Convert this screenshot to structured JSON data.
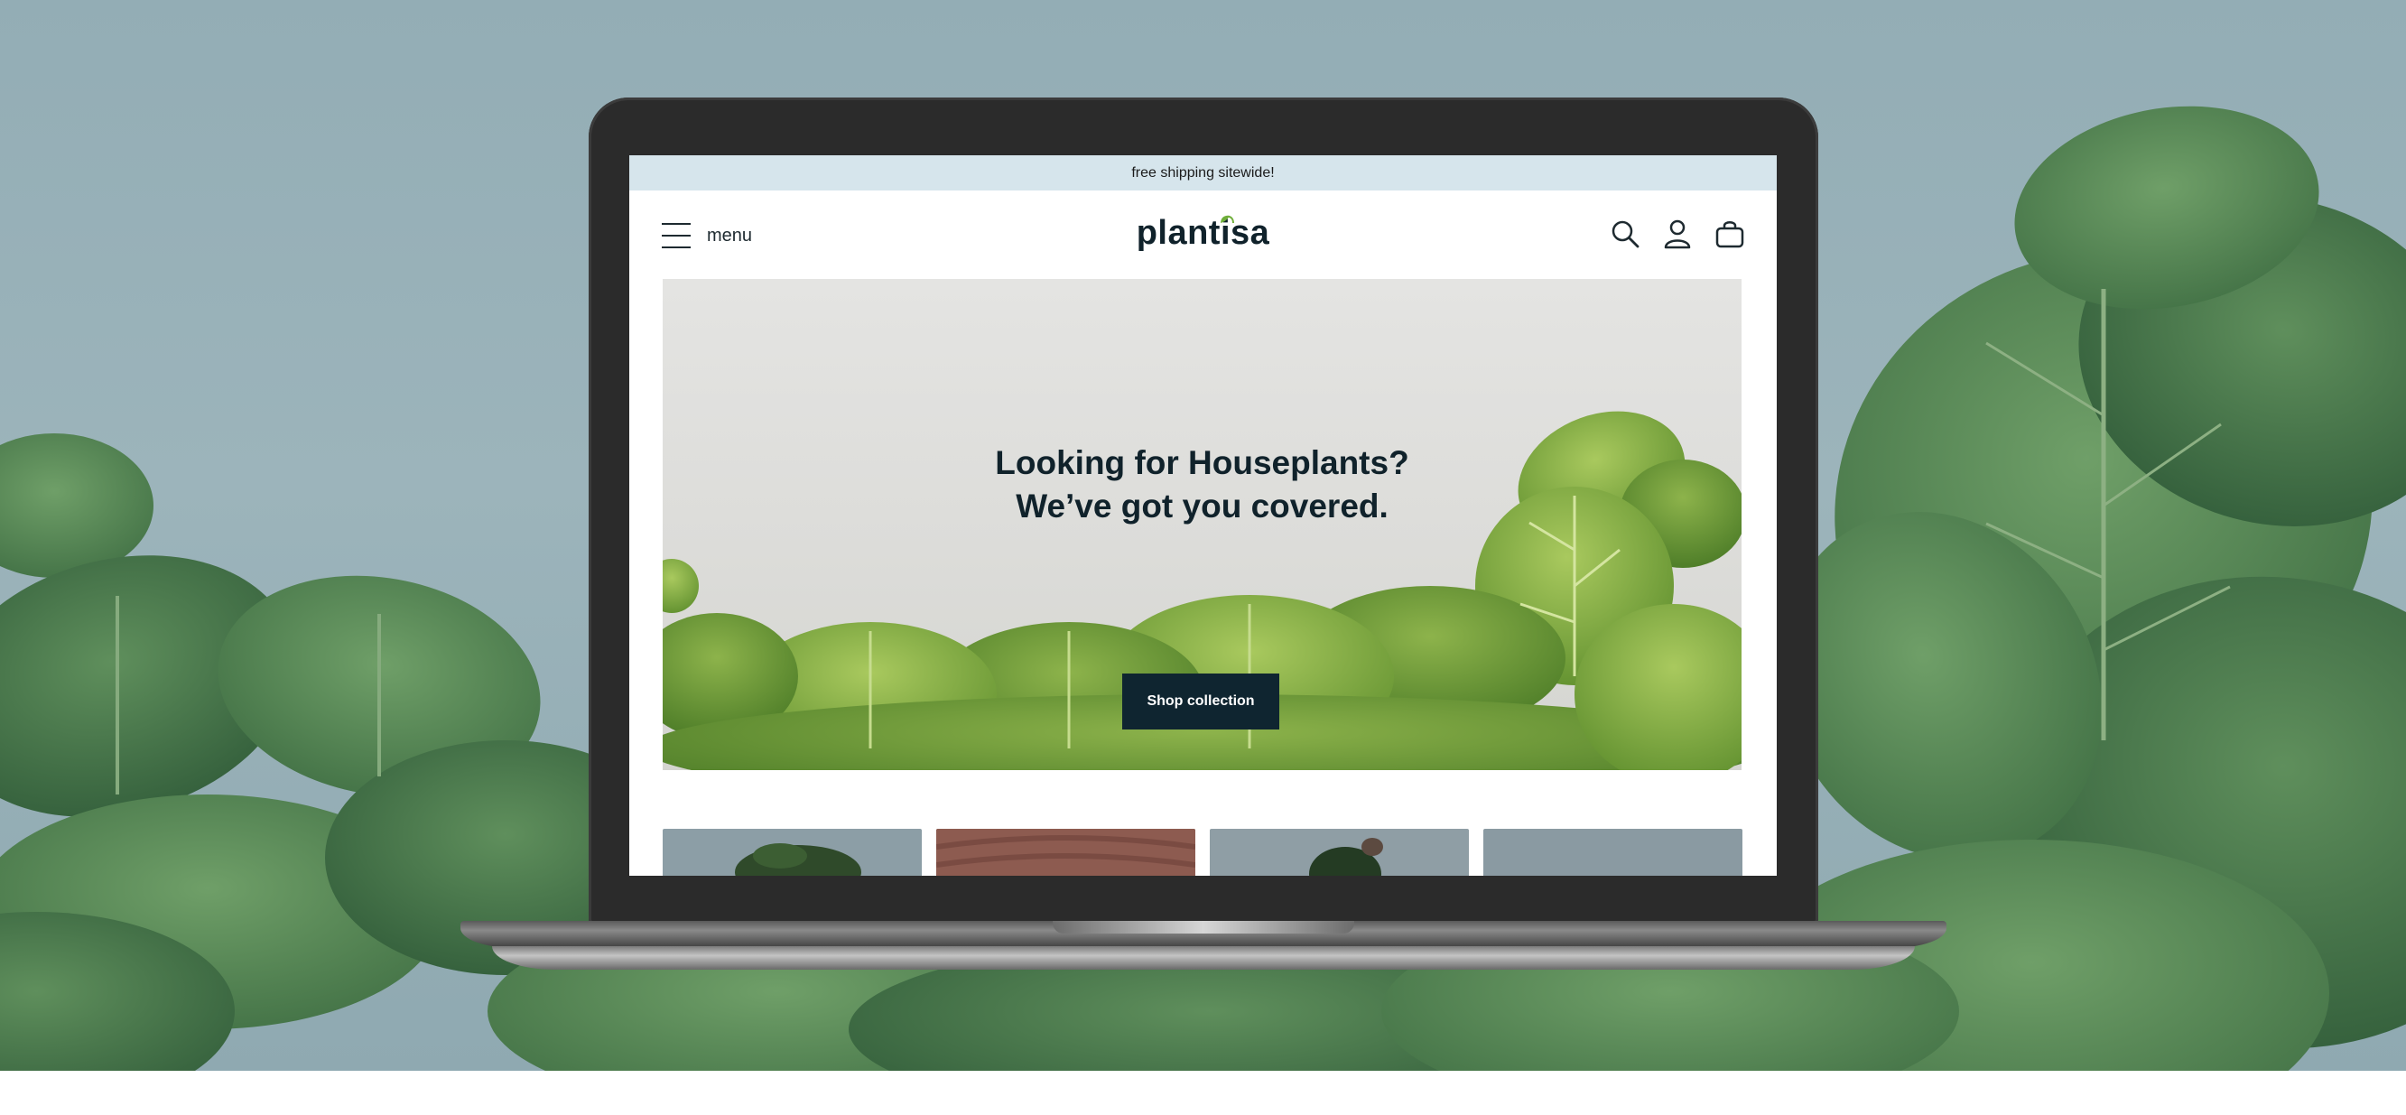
{
  "announcement": {
    "text": "free shipping sitewide!"
  },
  "header": {
    "menu_label": "menu",
    "logo_text": "plantisa",
    "icons": [
      "search-icon",
      "account-icon",
      "cart-icon"
    ]
  },
  "hero": {
    "title_line1": "Looking for Houseplants?",
    "title_line2": "We’ve got you covered.",
    "cta_label": "Shop collection"
  },
  "colors": {
    "announcement_bg": "#d6e5ec",
    "brand_dark": "#0f2530",
    "leaf_accent": "#6fae3a"
  }
}
